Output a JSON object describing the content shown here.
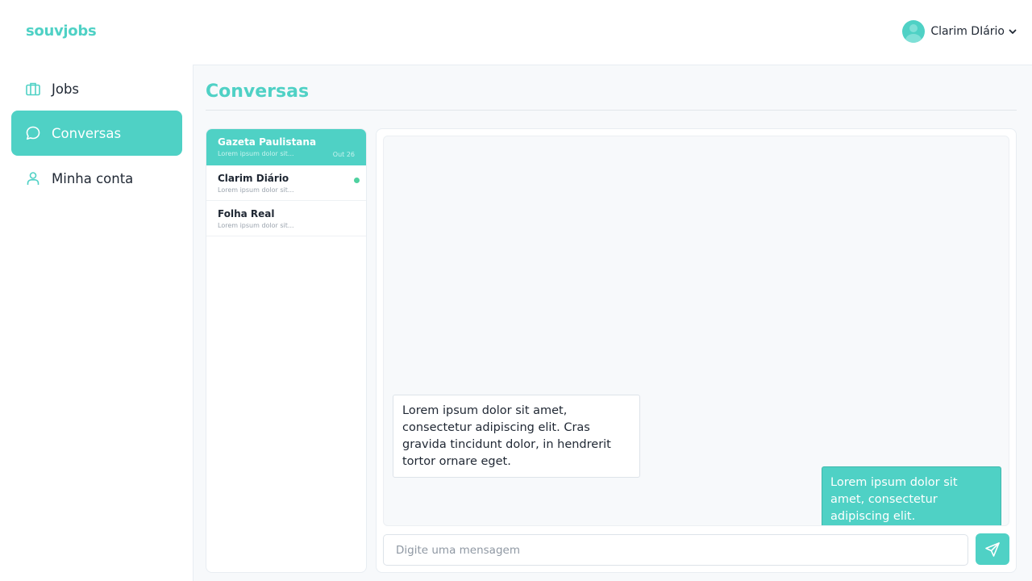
{
  "app": {
    "logo": "souvjobs",
    "accent_color": "#4fd1c5"
  },
  "user": {
    "name": "Clarim DIário",
    "avatar_icon": "user-avatar-icon",
    "menu_icon": "chevron-down-icon"
  },
  "sidebar": {
    "items": [
      {
        "label": "Jobs",
        "icon": "briefcase-icon",
        "active": false
      },
      {
        "label": "Conversas",
        "icon": "chat-bubble-icon",
        "active": true
      },
      {
        "label": "Minha conta",
        "icon": "user-icon",
        "active": false
      }
    ]
  },
  "page": {
    "title": "Conversas"
  },
  "conversations": [
    {
      "name": "Gazeta Paulistana",
      "preview": "Lorem ipsum dolor sit...",
      "date": "Out 26",
      "active": true,
      "unread": false
    },
    {
      "name": "Clarim Diário",
      "preview": "Lorem ipsum dolor sit...",
      "date": "",
      "active": false,
      "unread": true
    },
    {
      "name": "Folha Real",
      "preview": "Lorem ipsum dolor sit...",
      "date": "",
      "active": false,
      "unread": false
    }
  ],
  "messages": [
    {
      "direction": "incoming",
      "text": "Lorem ipsum dolor sit amet, consectetur adipiscing elit. Cras gravida tincidunt dolor, in hendrerit tortor ornare eget."
    },
    {
      "direction": "outgoing",
      "text": "Lorem ipsum dolor sit amet, consectetur adipiscing elit."
    }
  ],
  "composer": {
    "placeholder": "Digite uma mensagem",
    "value": "",
    "send_icon": "send-icon"
  }
}
